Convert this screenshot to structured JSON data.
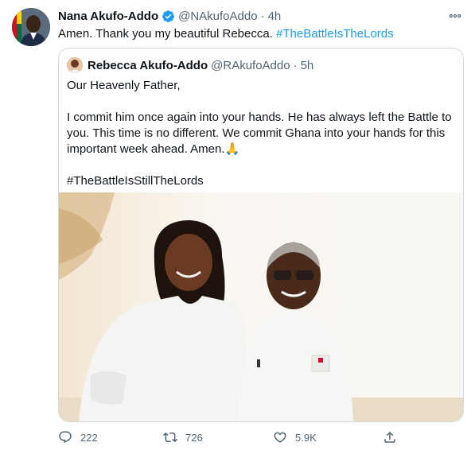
{
  "tweet": {
    "author_name": "Nana Akufo-Addo",
    "author_handle": "@NAkufoAddo",
    "separator": "·",
    "time": "4h",
    "more_label": "⦁⦁⦁",
    "text_plain": "Amen. Thank you my beautiful Rebecca. ",
    "text_hashtag": "#TheBattleIsTheLords"
  },
  "quoted": {
    "author_name": "Rebecca Akufo-Addo",
    "author_handle": "@RAkufoAddo",
    "separator": "·",
    "time": "5h",
    "line1": "Our Heavenly Father,",
    "line2": "I commit him once again into your hands. He has always left the Battle to\nyou. This time is no different. We commit Ghana into your hands for this\nimportant week ahead. Amen.🙏",
    "hashtag": "#TheBattleIsStillTheLords"
  },
  "actions": {
    "reply_count": "222",
    "retweet_count": "726",
    "like_count": "5.9K"
  },
  "colors": {
    "link": "#1d9bf0",
    "secondary_text": "#536471",
    "border": "#cfd9de",
    "verified": "#1d9bf0"
  }
}
